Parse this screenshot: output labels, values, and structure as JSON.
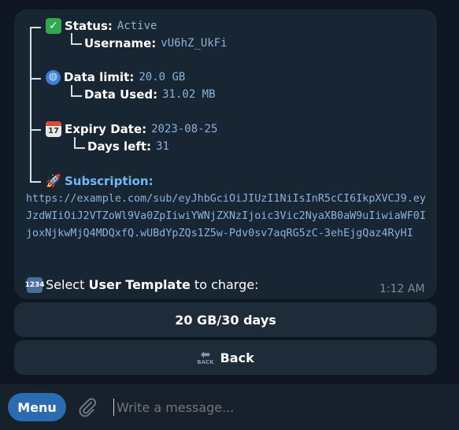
{
  "message": {
    "status_label": "Status:",
    "status_value": "Active",
    "username_label": "Username:",
    "username_value": "vU6hZ_UkFi",
    "data_limit_label": "Data limit:",
    "data_limit_value": "20.0 GB",
    "data_used_label": "Data Used:",
    "data_used_value": "31.02 MB",
    "expiry_label": "Expiry Date:",
    "expiry_value": "2023-08-25",
    "days_left_label": "Days left:",
    "days_left_value": "31",
    "subscription_label": "Subscription:",
    "subscription_url": "https://example.com/sub/eyJhbGciOiJIUzI1NiIsInR5cCI6IkpXVCJ9.eyJzdWIiOiJ2VTZoWl9Va0ZpIiwiYWNjZXNzIjoic3Vic2NyaXB0aW9uIiwiaWF0IjoxNjkwMjQ4MDQxfQ.wUBdYpZQs1Z5w-Pdv0sv7aqRG5zC-3ehEjgQaz4RyHI",
    "select_prefix": "Select ",
    "select_bold": "User Template",
    "select_suffix": " to charge:",
    "time": "1:12 AM"
  },
  "emojis": {
    "status": "check-mark-icon",
    "data": "globe-icon",
    "expiry": "calendar-icon",
    "subscription": "rocket-icon",
    "select": "numbers-icon",
    "calendar_day": "17",
    "numbers_glyph": "1234"
  },
  "keyboard": {
    "template_button": "20 GB/30 days",
    "back_button": "Back",
    "back_icon_text": "BACK"
  },
  "composer": {
    "menu_label": "Menu",
    "placeholder": "Write a message..."
  },
  "colors": {
    "background": "#0e1621",
    "bubble": "#182533",
    "link": "#71baf5",
    "code": "#8cb2d9",
    "menu": "#2b6cb0"
  }
}
